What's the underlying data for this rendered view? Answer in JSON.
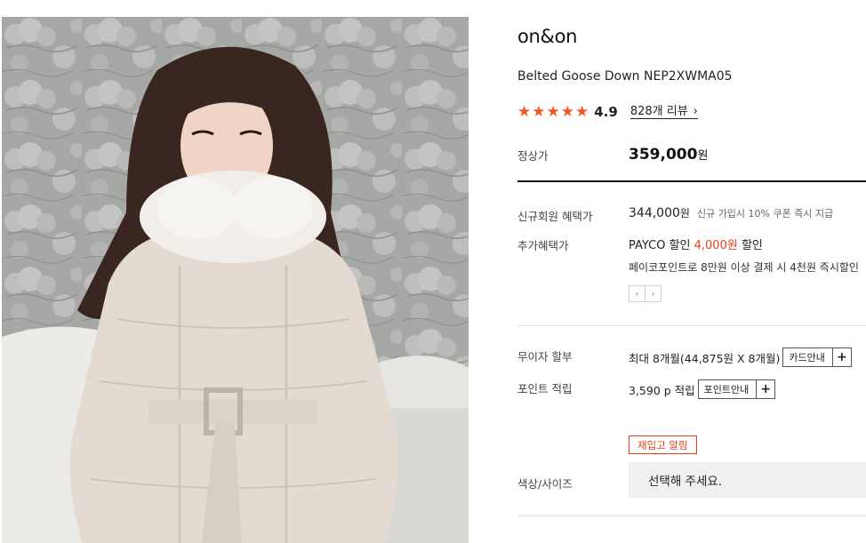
{
  "product": {
    "brand": "on&on",
    "name": "Belted Goose Down NEP2XWMA05"
  },
  "rating": {
    "score": "4.9",
    "stars": 5,
    "reviews_label": "828개 리뷰",
    "star_color": "#f4541f"
  },
  "price": {
    "regular_label": "정상가",
    "regular_value": "359,000",
    "currency": "원"
  },
  "benefits": {
    "member_label": "신규회원 혜택가",
    "member_value": "344,000",
    "currency": "원",
    "member_note": "신규 가입시 10% 쿠폰 즉시 지급",
    "extra_label": "추가혜택가",
    "extra_prefix": "PAYCO 할인",
    "extra_amount": "4,000원",
    "extra_suffix": "할인",
    "extra_note": "페이코포인트로 8만원 이상 결제 시 4천원 즉시할인",
    "accent_color": "#e8401c"
  },
  "pager": {
    "prev": "‹",
    "next": "›"
  },
  "installment": {
    "label": "무이자 할부",
    "value": "최대 8개월(44,875원 X 8개월)",
    "button": "카드안내"
  },
  "points": {
    "label": "포인트 적립",
    "value": "3,590 p 적립",
    "button": "포인트안내"
  },
  "restock_button": "재입고 알림",
  "option": {
    "label": "색상/사이즈",
    "placeholder": "선택해 주세요."
  }
}
